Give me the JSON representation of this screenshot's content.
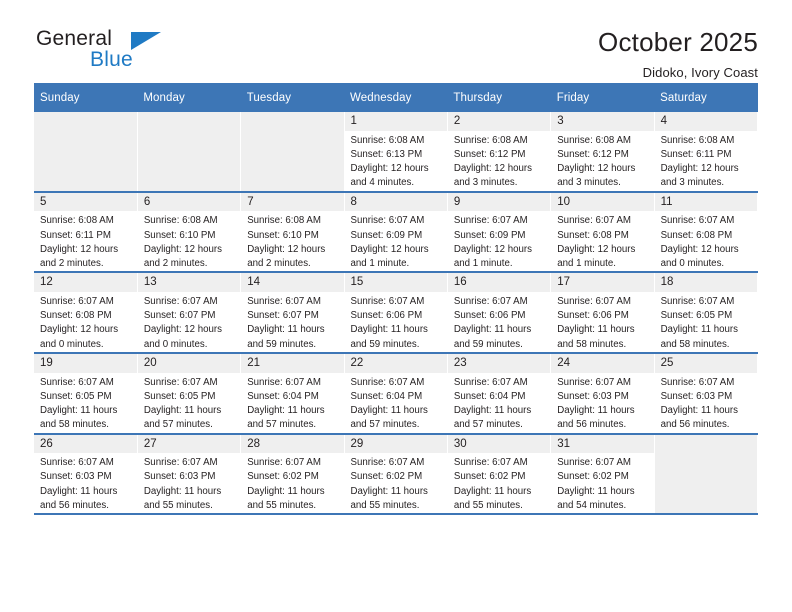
{
  "brand": {
    "line1": "General",
    "line2": "Blue",
    "triangle_icon": "triangle-icon",
    "accent_color": "#1f7ac4"
  },
  "header": {
    "title": "October 2025",
    "subtitle": "Didoko, Ivory Coast"
  },
  "theme": {
    "header_row_bg": "#3d76b6",
    "cell_header_bg": "#efefef",
    "text_color": "#231f20"
  },
  "calendar": {
    "weekday_headers": [
      "Sunday",
      "Monday",
      "Tuesday",
      "Wednesday",
      "Thursday",
      "Friday",
      "Saturday"
    ],
    "weeks": [
      [
        {
          "day": "",
          "sunrise": "",
          "sunset": "",
          "daylight_line1": "",
          "daylight_line2": "",
          "empty": true
        },
        {
          "day": "",
          "sunrise": "",
          "sunset": "",
          "daylight_line1": "",
          "daylight_line2": "",
          "empty": true
        },
        {
          "day": "",
          "sunrise": "",
          "sunset": "",
          "daylight_line1": "",
          "daylight_line2": "",
          "empty": true
        },
        {
          "day": "1",
          "sunrise": "Sunrise: 6:08 AM",
          "sunset": "Sunset: 6:13 PM",
          "daylight_line1": "Daylight: 12 hours",
          "daylight_line2": "and 4 minutes.",
          "empty": false
        },
        {
          "day": "2",
          "sunrise": "Sunrise: 6:08 AM",
          "sunset": "Sunset: 6:12 PM",
          "daylight_line1": "Daylight: 12 hours",
          "daylight_line2": "and 3 minutes.",
          "empty": false
        },
        {
          "day": "3",
          "sunrise": "Sunrise: 6:08 AM",
          "sunset": "Sunset: 6:12 PM",
          "daylight_line1": "Daylight: 12 hours",
          "daylight_line2": "and 3 minutes.",
          "empty": false
        },
        {
          "day": "4",
          "sunrise": "Sunrise: 6:08 AM",
          "sunset": "Sunset: 6:11 PM",
          "daylight_line1": "Daylight: 12 hours",
          "daylight_line2": "and 3 minutes.",
          "empty": false
        }
      ],
      [
        {
          "day": "5",
          "sunrise": "Sunrise: 6:08 AM",
          "sunset": "Sunset: 6:11 PM",
          "daylight_line1": "Daylight: 12 hours",
          "daylight_line2": "and 2 minutes.",
          "empty": false
        },
        {
          "day": "6",
          "sunrise": "Sunrise: 6:08 AM",
          "sunset": "Sunset: 6:10 PM",
          "daylight_line1": "Daylight: 12 hours",
          "daylight_line2": "and 2 minutes.",
          "empty": false
        },
        {
          "day": "7",
          "sunrise": "Sunrise: 6:08 AM",
          "sunset": "Sunset: 6:10 PM",
          "daylight_line1": "Daylight: 12 hours",
          "daylight_line2": "and 2 minutes.",
          "empty": false
        },
        {
          "day": "8",
          "sunrise": "Sunrise: 6:07 AM",
          "sunset": "Sunset: 6:09 PM",
          "daylight_line1": "Daylight: 12 hours",
          "daylight_line2": "and 1 minute.",
          "empty": false
        },
        {
          "day": "9",
          "sunrise": "Sunrise: 6:07 AM",
          "sunset": "Sunset: 6:09 PM",
          "daylight_line1": "Daylight: 12 hours",
          "daylight_line2": "and 1 minute.",
          "empty": false
        },
        {
          "day": "10",
          "sunrise": "Sunrise: 6:07 AM",
          "sunset": "Sunset: 6:08 PM",
          "daylight_line1": "Daylight: 12 hours",
          "daylight_line2": "and 1 minute.",
          "empty": false
        },
        {
          "day": "11",
          "sunrise": "Sunrise: 6:07 AM",
          "sunset": "Sunset: 6:08 PM",
          "daylight_line1": "Daylight: 12 hours",
          "daylight_line2": "and 0 minutes.",
          "empty": false
        }
      ],
      [
        {
          "day": "12",
          "sunrise": "Sunrise: 6:07 AM",
          "sunset": "Sunset: 6:08 PM",
          "daylight_line1": "Daylight: 12 hours",
          "daylight_line2": "and 0 minutes.",
          "empty": false
        },
        {
          "day": "13",
          "sunrise": "Sunrise: 6:07 AM",
          "sunset": "Sunset: 6:07 PM",
          "daylight_line1": "Daylight: 12 hours",
          "daylight_line2": "and 0 minutes.",
          "empty": false
        },
        {
          "day": "14",
          "sunrise": "Sunrise: 6:07 AM",
          "sunset": "Sunset: 6:07 PM",
          "daylight_line1": "Daylight: 11 hours",
          "daylight_line2": "and 59 minutes.",
          "empty": false
        },
        {
          "day": "15",
          "sunrise": "Sunrise: 6:07 AM",
          "sunset": "Sunset: 6:06 PM",
          "daylight_line1": "Daylight: 11 hours",
          "daylight_line2": "and 59 minutes.",
          "empty": false
        },
        {
          "day": "16",
          "sunrise": "Sunrise: 6:07 AM",
          "sunset": "Sunset: 6:06 PM",
          "daylight_line1": "Daylight: 11 hours",
          "daylight_line2": "and 59 minutes.",
          "empty": false
        },
        {
          "day": "17",
          "sunrise": "Sunrise: 6:07 AM",
          "sunset": "Sunset: 6:06 PM",
          "daylight_line1": "Daylight: 11 hours",
          "daylight_line2": "and 58 minutes.",
          "empty": false
        },
        {
          "day": "18",
          "sunrise": "Sunrise: 6:07 AM",
          "sunset": "Sunset: 6:05 PM",
          "daylight_line1": "Daylight: 11 hours",
          "daylight_line2": "and 58 minutes.",
          "empty": false
        }
      ],
      [
        {
          "day": "19",
          "sunrise": "Sunrise: 6:07 AM",
          "sunset": "Sunset: 6:05 PM",
          "daylight_line1": "Daylight: 11 hours",
          "daylight_line2": "and 58 minutes.",
          "empty": false
        },
        {
          "day": "20",
          "sunrise": "Sunrise: 6:07 AM",
          "sunset": "Sunset: 6:05 PM",
          "daylight_line1": "Daylight: 11 hours",
          "daylight_line2": "and 57 minutes.",
          "empty": false
        },
        {
          "day": "21",
          "sunrise": "Sunrise: 6:07 AM",
          "sunset": "Sunset: 6:04 PM",
          "daylight_line1": "Daylight: 11 hours",
          "daylight_line2": "and 57 minutes.",
          "empty": false
        },
        {
          "day": "22",
          "sunrise": "Sunrise: 6:07 AM",
          "sunset": "Sunset: 6:04 PM",
          "daylight_line1": "Daylight: 11 hours",
          "daylight_line2": "and 57 minutes.",
          "empty": false
        },
        {
          "day": "23",
          "sunrise": "Sunrise: 6:07 AM",
          "sunset": "Sunset: 6:04 PM",
          "daylight_line1": "Daylight: 11 hours",
          "daylight_line2": "and 57 minutes.",
          "empty": false
        },
        {
          "day": "24",
          "sunrise": "Sunrise: 6:07 AM",
          "sunset": "Sunset: 6:03 PM",
          "daylight_line1": "Daylight: 11 hours",
          "daylight_line2": "and 56 minutes.",
          "empty": false
        },
        {
          "day": "25",
          "sunrise": "Sunrise: 6:07 AM",
          "sunset": "Sunset: 6:03 PM",
          "daylight_line1": "Daylight: 11 hours",
          "daylight_line2": "and 56 minutes.",
          "empty": false
        }
      ],
      [
        {
          "day": "26",
          "sunrise": "Sunrise: 6:07 AM",
          "sunset": "Sunset: 6:03 PM",
          "daylight_line1": "Daylight: 11 hours",
          "daylight_line2": "and 56 minutes.",
          "empty": false
        },
        {
          "day": "27",
          "sunrise": "Sunrise: 6:07 AM",
          "sunset": "Sunset: 6:03 PM",
          "daylight_line1": "Daylight: 11 hours",
          "daylight_line2": "and 55 minutes.",
          "empty": false
        },
        {
          "day": "28",
          "sunrise": "Sunrise: 6:07 AM",
          "sunset": "Sunset: 6:02 PM",
          "daylight_line1": "Daylight: 11 hours",
          "daylight_line2": "and 55 minutes.",
          "empty": false
        },
        {
          "day": "29",
          "sunrise": "Sunrise: 6:07 AM",
          "sunset": "Sunset: 6:02 PM",
          "daylight_line1": "Daylight: 11 hours",
          "daylight_line2": "and 55 minutes.",
          "empty": false
        },
        {
          "day": "30",
          "sunrise": "Sunrise: 6:07 AM",
          "sunset": "Sunset: 6:02 PM",
          "daylight_line1": "Daylight: 11 hours",
          "daylight_line2": "and 55 minutes.",
          "empty": false
        },
        {
          "day": "31",
          "sunrise": "Sunrise: 6:07 AM",
          "sunset": "Sunset: 6:02 PM",
          "daylight_line1": "Daylight: 11 hours",
          "daylight_line2": "and 54 minutes.",
          "empty": false
        },
        {
          "day": "",
          "sunrise": "",
          "sunset": "",
          "daylight_line1": "",
          "daylight_line2": "",
          "empty": true
        }
      ]
    ]
  }
}
